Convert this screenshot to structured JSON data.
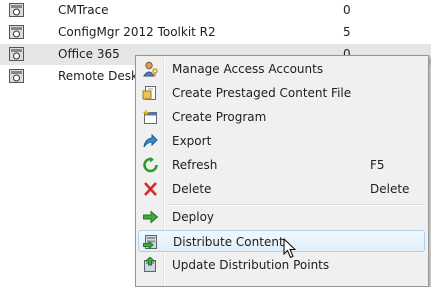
{
  "package_list": [
    {
      "name": "CMTrace",
      "count": "0",
      "selected": false
    },
    {
      "name": "ConfigMgr 2012 Toolkit R2",
      "count": "5",
      "selected": false
    },
    {
      "name": "Office 365",
      "count": "0",
      "selected": true
    },
    {
      "name": "Remote Desktop",
      "count": "",
      "selected": false
    }
  ],
  "context_menu": {
    "items": [
      {
        "label": "Manage Access Accounts",
        "icon": "key-user-icon",
        "shortcut": ""
      },
      {
        "label": "Create Prestaged Content File",
        "icon": "prestaged-file-icon",
        "shortcut": ""
      },
      {
        "label": "Create Program",
        "icon": "create-program-icon",
        "shortcut": ""
      },
      {
        "label": "Export",
        "icon": "export-arrow-icon",
        "shortcut": ""
      },
      {
        "label": "Refresh",
        "icon": "refresh-icon",
        "shortcut": "F5"
      },
      {
        "label": "Delete",
        "icon": "delete-x-icon",
        "shortcut": "Delete"
      },
      {
        "label": "Deploy",
        "icon": "deploy-arrow-icon",
        "shortcut": ""
      },
      {
        "label": "Distribute Content",
        "icon": "distribute-content-icon",
        "shortcut": ""
      },
      {
        "label": "Update Distribution Points",
        "icon": "update-distribution-points-icon",
        "shortcut": ""
      }
    ],
    "hovered_item": "Distribute Content"
  },
  "colors": {
    "selected_row": "#e6e6e6",
    "menu_background": "#f0f0f0",
    "hover_border": "#aed0ee",
    "delete_red": "#d42a2a",
    "refresh_green": "#2f9a2f",
    "export_blue": "#3a86d0"
  }
}
